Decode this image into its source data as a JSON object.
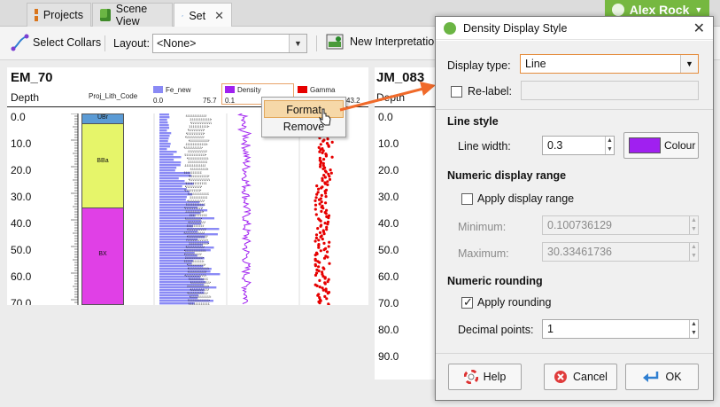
{
  "tabs": [
    {
      "label": "Projects",
      "icon": "projects-grid-icon"
    },
    {
      "label": "Scene View",
      "icon": "scene-cube-icon"
    },
    {
      "label": "Set",
      "icon": "set-log-icon",
      "active": true
    }
  ],
  "user": {
    "name": "Alex Rock"
  },
  "toolbar": {
    "select_collars": "Select Collars",
    "layout_label": "Layout:",
    "layout_value": "<None>",
    "new_interpretation": "New Interpretatio"
  },
  "log": {
    "hole1": "EM_70",
    "hole2": "JM_083",
    "depth_label": "Depth",
    "depth_label2": "Depth",
    "lith_column": "Proj_Lith_Code",
    "columns": [
      {
        "name": "Fe_new",
        "color": "#8a8af5",
        "min": "0.0",
        "max": "75.7"
      },
      {
        "name": "Density",
        "color": "#a020f0",
        "min": "0.1",
        "max": ""
      },
      {
        "name": "Gamma",
        "color": "#e60000",
        "min": "",
        "max": "43.2"
      }
    ],
    "lith_units": [
      "UBr",
      "BBa",
      "BX"
    ],
    "depth_ticks1": [
      "0.0",
      "10.0",
      "20.0",
      "30.0",
      "40.0",
      "50.0",
      "60.0",
      "70.0"
    ],
    "depth_ticks2": [
      "0.0",
      "10.0",
      "20.0",
      "30.0",
      "40.0",
      "50.0",
      "60.0",
      "70.0",
      "80.0",
      "90.0"
    ]
  },
  "context_menu": {
    "format": "Format",
    "remove": "Remove"
  },
  "dialog": {
    "title": "Density Display Style",
    "display_type_label": "Display type:",
    "display_type_value": "Line",
    "relabel_label": "Re-label:",
    "line_style_section": "Line style",
    "line_width_label": "Line width:",
    "line_width_value": "0.3",
    "colour_button": "Colour",
    "line_colour": "#a020f0",
    "numeric_range_section": "Numeric display range",
    "apply_range_label": "Apply display range",
    "minimum_label": "Minimum:",
    "minimum_value": "0.100736129",
    "maximum_label": "Maximum:",
    "maximum_value": "30.33461736",
    "rounding_section": "Numeric rounding",
    "apply_rounding_label": "Apply rounding",
    "decimal_points_label": "Decimal points:",
    "decimal_points_value": "1",
    "help_button": "Help",
    "cancel_button": "Cancel",
    "ok_button": "OK"
  },
  "colors": {
    "accent_orange": "#f06a2a",
    "lith_ubr": "#5b9bd5",
    "lith_bba": "#e6f56a",
    "lith_bx": "#e040e6"
  }
}
